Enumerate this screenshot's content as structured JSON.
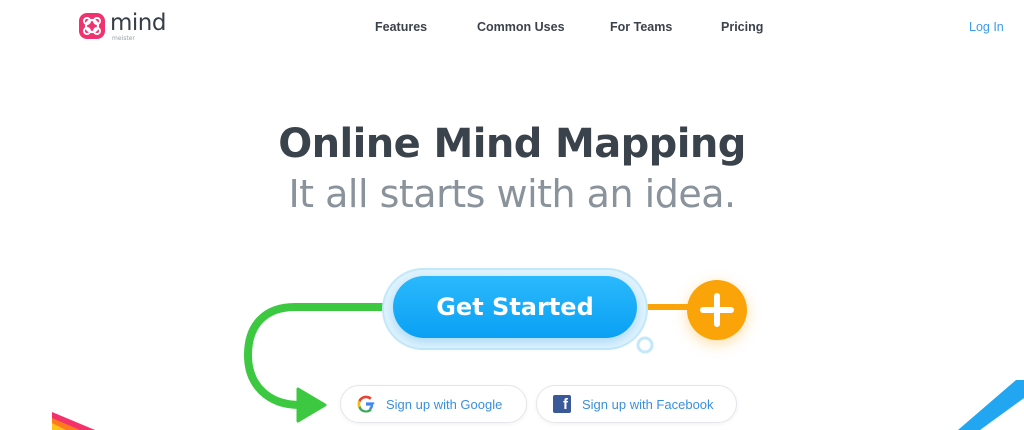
{
  "header": {
    "logo": {
      "word": "mind",
      "sub": "meister"
    },
    "nav": [
      {
        "label": "Features"
      },
      {
        "label": "Common Uses"
      },
      {
        "label": "For Teams"
      },
      {
        "label": "Pricing"
      }
    ],
    "login_label": "Log In"
  },
  "hero": {
    "title": "Online Mind Mapping",
    "subtitle": "It all starts with an idea."
  },
  "cta": {
    "label": "Get Started",
    "plus_icon": "plus-icon"
  },
  "signup": {
    "google_label": "Sign up with Google",
    "facebook_label": "Sign up with Facebook",
    "google_icon": "google-icon",
    "facebook_icon": "facebook-icon"
  },
  "colors": {
    "brand_pink": "#f0326e",
    "primary_blue": "#0aa0f4",
    "accent_orange": "#fba40a",
    "connector_green": "#3cc840",
    "link_blue": "#3a9cf0",
    "title_dark": "#3a424b",
    "subtitle_gray": "#8a939c"
  }
}
